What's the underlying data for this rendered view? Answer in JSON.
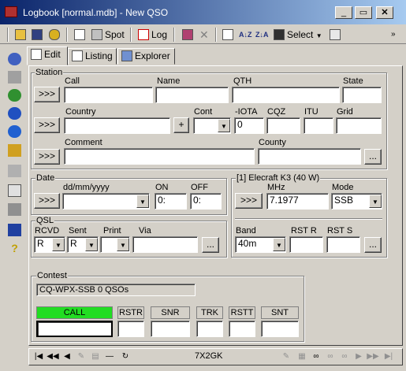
{
  "window": {
    "title": "Logbook [normal.mdb] - New QSO"
  },
  "toolbar": {
    "spot_label": "Spot",
    "log_label": "Log",
    "select_label": "Select"
  },
  "tabs": [
    {
      "label": "Edit"
    },
    {
      "label": "Listing"
    },
    {
      "label": "Explorer"
    }
  ],
  "station": {
    "legend": "Station",
    "row1_button": ">>>",
    "row2_button": ">>>",
    "row3_button": ">>>",
    "call_label": "Call",
    "call_value": "",
    "name_label": "Name",
    "name_value": "",
    "qth_label": "QTH",
    "qth_value": "",
    "state_label": "State",
    "state_value": "",
    "country_label": "Country",
    "country_value": "",
    "plus_label": "+",
    "cont_label": "Cont",
    "cont_value": "",
    "iota_label": "-IOTA",
    "iota_value": "0",
    "cqz_label": "CQZ",
    "cqz_value": "",
    "itu_label": "ITU",
    "itu_value": "",
    "grid_label": "Grid",
    "grid_value": "",
    "comment_label": "Comment",
    "comment_value": "",
    "county_label": "County",
    "county_value": "",
    "ellipsis": "..."
  },
  "date": {
    "legend": "Date",
    "button": ">>>",
    "format_label": "dd/mm/yyyy",
    "date_value": "",
    "on_label": "ON",
    "on_value": "0:",
    "off_label": "OFF",
    "off_value": "0:"
  },
  "qsl": {
    "legend": "QSL",
    "rcvd_label": "RCVD",
    "rcvd_value": "R",
    "sent_label": "Sent",
    "sent_value": "R",
    "print_label": "Print",
    "print_value": "",
    "via_label": "Via",
    "via_value": "",
    "ellipsis": "..."
  },
  "radio": {
    "legend": "[1] Elecraft K3 (40 W)",
    "button": ">>>",
    "mhz_label": "MHz",
    "mhz_value": "7.1977",
    "mode_label": "Mode",
    "mode_value": "SSB",
    "band_label": "Band",
    "band_value": "40m",
    "rstr_label": "RST R",
    "rstr_value": "",
    "rsts_label": "RST S",
    "rsts_value": "",
    "ellipsis": "..."
  },
  "contest": {
    "legend": "Contest",
    "status": "CQ-WPX-SSB 0 QSOs",
    "columns": [
      "CALL",
      "RSTR",
      "SNR",
      "TRK",
      "RSTT",
      "SNT"
    ],
    "call_value": ""
  },
  "nav": {
    "callsign": "7X2GK"
  },
  "colors": {
    "title_left": "#0a246a",
    "title_right": "#a6caf0",
    "call_header": "#22dd22",
    "face": "#d4d0c8"
  }
}
